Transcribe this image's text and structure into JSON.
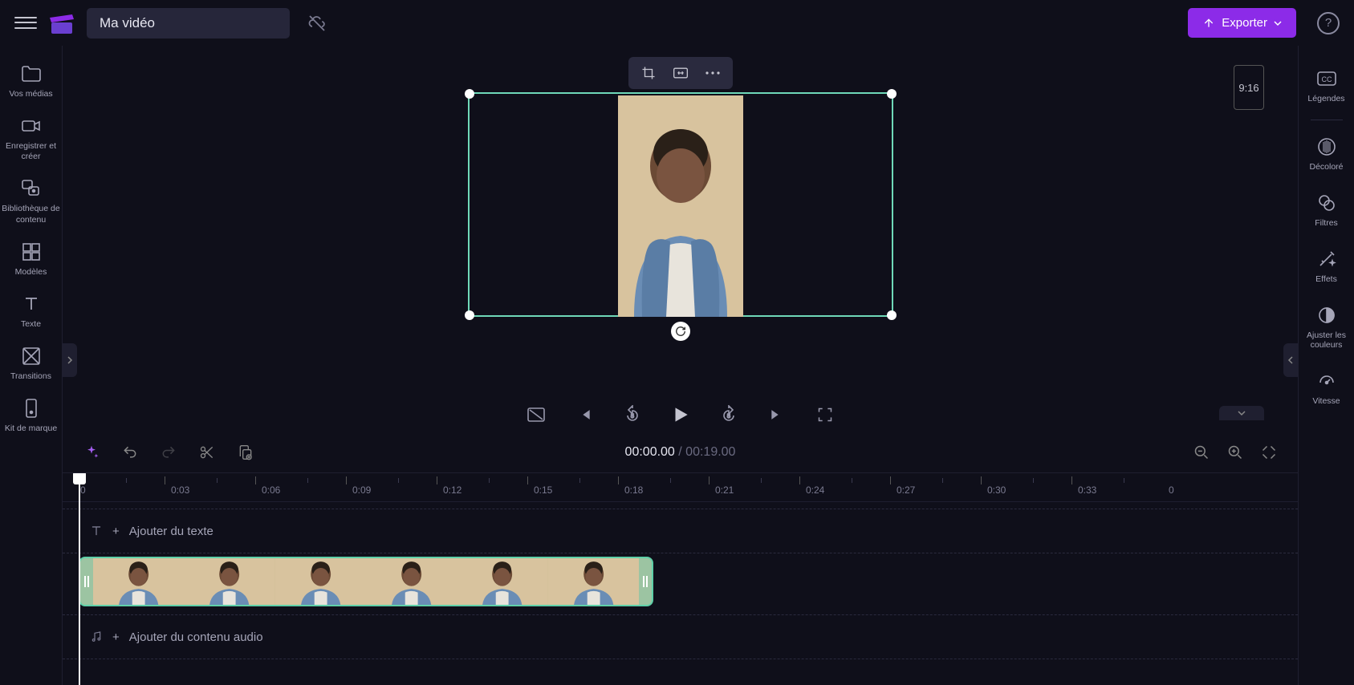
{
  "project_title": "Ma vidéo",
  "export_label": "Exporter",
  "aspect_ratio": "9:16",
  "left_sidebar": {
    "items": [
      {
        "label": "Vos médias"
      },
      {
        "label": "Enregistrer et créer"
      },
      {
        "label": "Bibliothèque de contenu"
      },
      {
        "label": "Modèles"
      },
      {
        "label": "Texte"
      },
      {
        "label": "Transitions"
      },
      {
        "label": "Kit de marque"
      }
    ]
  },
  "right_sidebar": {
    "items": [
      {
        "label": "Légendes"
      },
      {
        "label": "Décoloré"
      },
      {
        "label": "Filtres"
      },
      {
        "label": "Effets"
      },
      {
        "label": "Ajuster les couleurs"
      },
      {
        "label": "Vitesse"
      }
    ]
  },
  "time": {
    "current": "00:00.00",
    "separator": " / ",
    "duration": "00:19.00"
  },
  "timeline": {
    "start_label": "0",
    "marks": [
      "0:03",
      "0:06",
      "0:09",
      "0:12",
      "0:15",
      "0:18",
      "0:21",
      "0:24",
      "0:27",
      "0:30",
      "0:33"
    ],
    "end_label": "0",
    "text_track_label": "Ajouter du texte",
    "audio_track_label": "Ajouter du contenu audio"
  },
  "colors": {
    "accent": "#8c2be8",
    "selection_border": "#6fd8b8"
  }
}
